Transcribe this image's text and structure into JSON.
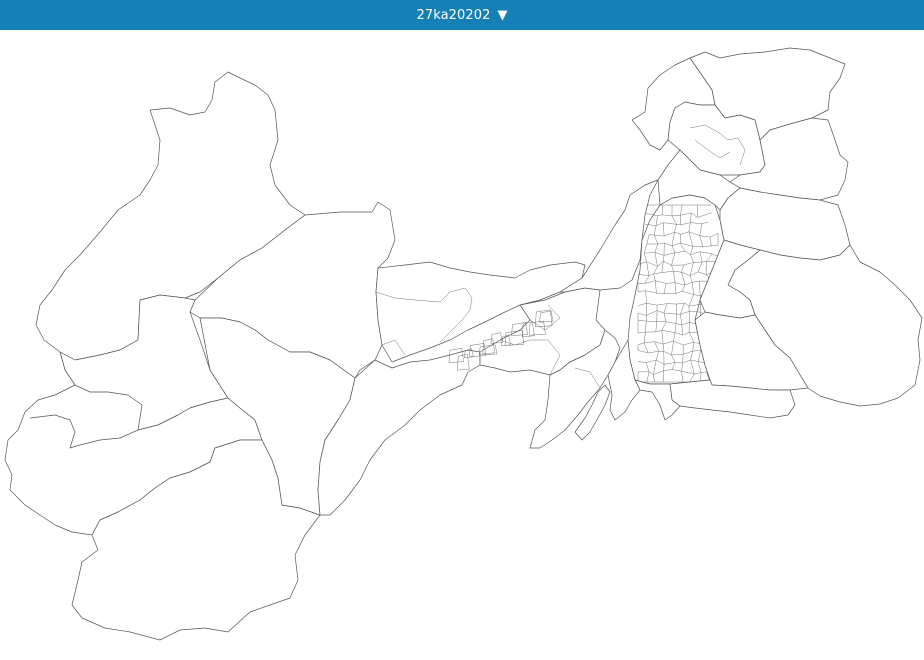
{
  "header": {
    "title": "27ka20202",
    "dropdown_icon": "triangle-down-icon",
    "background_color": "#1580b6",
    "text_color": "#ffffff"
  },
  "map": {
    "type": "boundary-map",
    "fill_color": "#ffffff",
    "stroke_color": "#555555"
  }
}
